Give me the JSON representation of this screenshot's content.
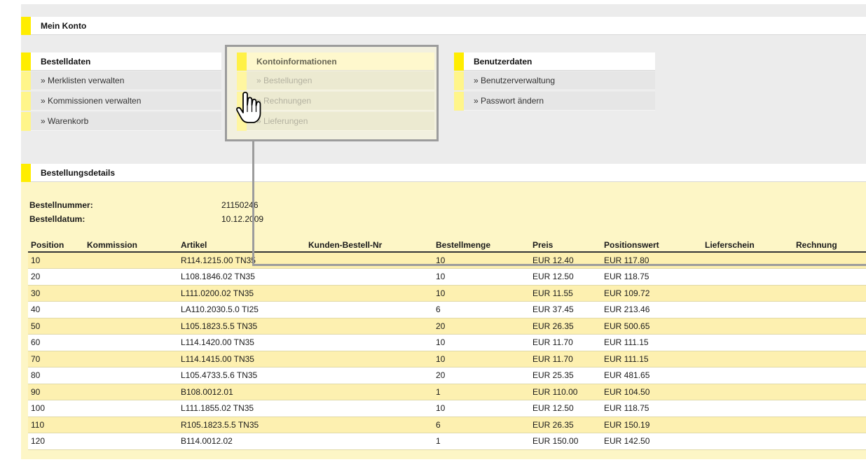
{
  "header": {
    "title": "Mein Konto"
  },
  "menus": {
    "bestelldaten": {
      "title": "Bestelldaten",
      "items": [
        "» Merklisten verwalten",
        "» Kommissionen verwalten",
        "» Warenkorb"
      ]
    },
    "kontoinformationen": {
      "title": "Kontoinformationen",
      "items": [
        "» Bestellungen",
        "» Rechnungen",
        "» Lieferungen"
      ]
    },
    "benutzerdaten": {
      "title": "Benutzerdaten",
      "items": [
        "» Benutzerverwaltung",
        "» Passwort ändern"
      ]
    }
  },
  "details": {
    "title": "Bestellungsdetails",
    "order_number_label": "Bestellnummer:",
    "order_number": "21150246",
    "order_date_label": "Bestelldatum:",
    "order_date": "10.12.2009"
  },
  "table": {
    "columns": [
      "Position",
      "Kommission",
      "Artikel",
      "Kunden-Bestell-Nr",
      "Bestellmenge",
      "Preis",
      "Positionswert",
      "Lieferschein",
      "Rechnung"
    ],
    "rows": [
      [
        "10",
        "",
        "R114.1215.00 TN35",
        "",
        "10",
        "EUR 12.40",
        "EUR 117.80",
        "",
        ""
      ],
      [
        "20",
        "",
        "L108.1846.02 TN35",
        "",
        "10",
        "EUR 12.50",
        "EUR 118.75",
        "",
        ""
      ],
      [
        "30",
        "",
        "L111.0200.02 TN35",
        "",
        "10",
        "EUR 11.55",
        "EUR 109.72",
        "",
        ""
      ],
      [
        "40",
        "",
        "LA110.2030.5.0 TI25",
        "",
        "6",
        "EUR 37.45",
        "EUR 213.46",
        "",
        ""
      ],
      [
        "50",
        "",
        "L105.1823.5.5 TN35",
        "",
        "20",
        "EUR 26.35",
        "EUR 500.65",
        "",
        ""
      ],
      [
        "60",
        "",
        "L114.1420.00 TN35",
        "",
        "10",
        "EUR 11.70",
        "EUR 111.15",
        "",
        ""
      ],
      [
        "70",
        "",
        "L114.1415.00 TN35",
        "",
        "10",
        "EUR 11.70",
        "EUR 111.15",
        "",
        ""
      ],
      [
        "80",
        "",
        "L105.4733.5.6 TN35",
        "",
        "20",
        "EUR 25.35",
        "EUR 481.65",
        "",
        ""
      ],
      [
        "90",
        "",
        "B108.0012.01",
        "",
        "1",
        "EUR 110.00",
        "EUR 104.50",
        "",
        ""
      ],
      [
        "100",
        "",
        "L111.1855.02 TN35",
        "",
        "10",
        "EUR 12.50",
        "EUR 118.75",
        "",
        ""
      ],
      [
        "110",
        "",
        "R105.1823.5.5 TN35",
        "",
        "6",
        "EUR 26.35",
        "EUR 150.19",
        "",
        ""
      ],
      [
        "120",
        "",
        "B114.0012.02",
        "",
        "1",
        "EUR 150.00",
        "EUR 142.50",
        "",
        ""
      ]
    ]
  },
  "colors": {
    "accent": "#ffed00",
    "accent_light": "#fff58a",
    "row_alt": "#fdf0b0",
    "callout": "#9c9c9c"
  },
  "icons": {
    "cursor": "hand-pointer-icon"
  }
}
